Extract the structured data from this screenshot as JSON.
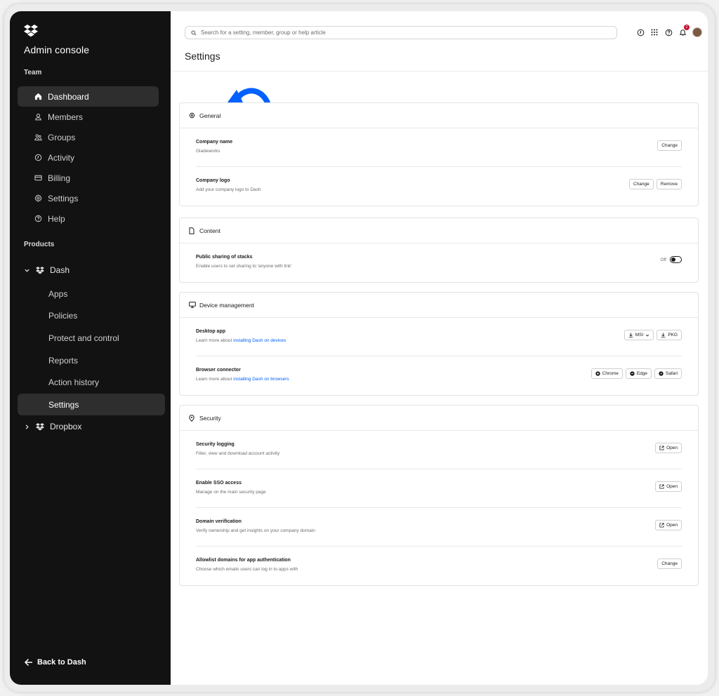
{
  "sidebar": {
    "app_title": "Admin console",
    "team_label": "Team",
    "team_items": [
      {
        "label": "Dashboard",
        "icon": "home-icon"
      },
      {
        "label": "Members",
        "icon": "person-icon"
      },
      {
        "label": "Groups",
        "icon": "group-icon"
      },
      {
        "label": "Activity",
        "icon": "clock-icon"
      },
      {
        "label": "Billing",
        "icon": "card-icon"
      },
      {
        "label": "Settings",
        "icon": "gear-icon"
      },
      {
        "label": "Help",
        "icon": "help-icon"
      }
    ],
    "products_label": "Products",
    "dash_label": "Dash",
    "dash_items": [
      "Apps",
      "Policies",
      "Protect and control",
      "Reports",
      "Action history",
      "Settings"
    ],
    "dropbox_label": "Dropbox",
    "back_label": "Back to Dash"
  },
  "header": {
    "search_placeholder": "Search for a setting, member, group or help article",
    "notification_count": "2",
    "page_title": "Settings"
  },
  "general": {
    "title": "General",
    "company_name_title": "Company name",
    "company_name_value": "Gladeworks",
    "company_name_btn": "Change",
    "logo_title": "Company logo",
    "logo_desc": "Add your company logo to Dash",
    "logo_change_btn": "Change",
    "logo_remove_btn": "Remove"
  },
  "content": {
    "title": "Content",
    "sharing_title": "Public sharing of stacks",
    "sharing_desc": "Enable users to set sharing to 'anyone with link'",
    "toggle_label": "Off"
  },
  "device": {
    "title": "Device management",
    "desktop_title": "Desktop app",
    "desktop_desc": "Learn more about ",
    "desktop_link": "installing Dash on devices",
    "msi_btn": "MSI",
    "pkg_btn": "PKG",
    "browser_title": "Browser connector",
    "browser_desc": "Learn more about ",
    "browser_link": "installing Dash on browsers",
    "chrome_btn": "Chrome",
    "edge_btn": "Edge",
    "safari_btn": "Safari"
  },
  "security": {
    "title": "Security",
    "rows": [
      {
        "title": "Security logging",
        "desc": "Filter, view and download account activity",
        "btn": "Open"
      },
      {
        "title": "Enable SSO access",
        "desc": "Manage on the main security page",
        "btn": "Open"
      },
      {
        "title": "Domain verification",
        "desc": "Verify ownership and get insights on your company domain",
        "btn": "Open"
      },
      {
        "title": "Allowlist domains for app authentication",
        "desc": "Choose which emails users can log in to apps with",
        "btn": "Change"
      }
    ]
  },
  "colors": {
    "sidebar_bg": "#121212",
    "accent": "#0061fe",
    "link": "#0061fe"
  }
}
